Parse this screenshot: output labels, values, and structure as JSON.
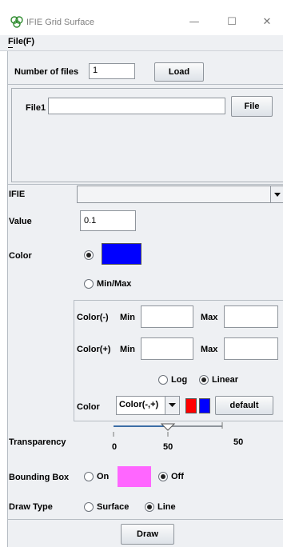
{
  "window": {
    "title": "IFIE Grid Surface",
    "minimize": "—",
    "maximize": "☐",
    "close": "✕"
  },
  "menu": {
    "file": "File(F)"
  },
  "files": {
    "number_label": "Number of files",
    "number_value": "1",
    "load_label": "Load"
  },
  "file1": {
    "label": "File1",
    "value": "",
    "button": "File"
  },
  "ifie": {
    "label": "IFIE",
    "value": ""
  },
  "value": {
    "label": "Value",
    "value": "0.1"
  },
  "color": {
    "label": "Color",
    "swatch": "#0000ff",
    "minmax_label": "Min/Max"
  },
  "minmax": {
    "neg": {
      "label": "Color(-)",
      "min_label": "Min",
      "min_value": "",
      "max_label": "Max",
      "max_value": ""
    },
    "pos": {
      "label": "Color(+)",
      "min_label": "Min",
      "min_value": "",
      "max_label": "Max",
      "max_value": ""
    },
    "scale": {
      "log_label": "Log",
      "linear_label": "Linear",
      "selected": "Linear"
    },
    "color_row": {
      "label": "Color",
      "select_value": "Color(-,+)",
      "swatch_neg": "#ff0000",
      "swatch_pos": "#0000ff",
      "default_label": "default"
    }
  },
  "transparency": {
    "label": "Transparency",
    "tick_min": "0",
    "tick_mid": "50",
    "value_text": "50",
    "fraction": 0.5
  },
  "bounding_box": {
    "label": "Bounding Box",
    "on_label": "On",
    "off_label": "Off",
    "swatch": "#ff66ff",
    "selected": "Off"
  },
  "draw_type": {
    "label": "Draw Type",
    "surface_label": "Surface",
    "line_label": "Line",
    "selected": "Line"
  },
  "draw_button": "Draw"
}
